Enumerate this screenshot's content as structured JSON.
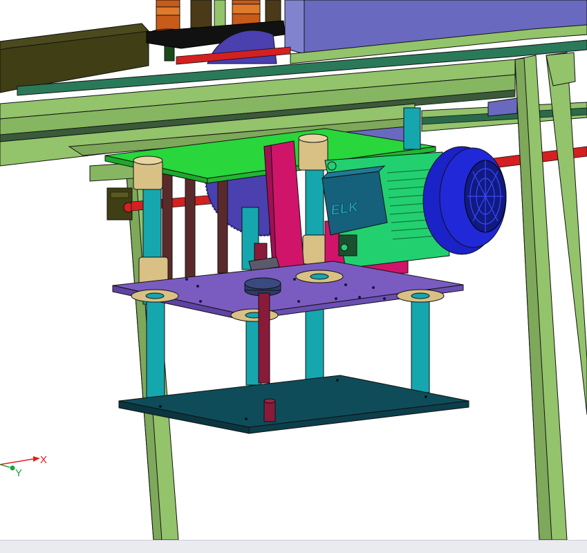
{
  "viewport": {
    "background": "#ffffff",
    "status_text": ""
  },
  "triad": {
    "x_label": "X",
    "y_label": "Y",
    "x_color": "#e0201e",
    "y_color": "#1ca23a"
  },
  "model": {
    "motor_brand": "ELK",
    "colors": {
      "frame": "#93c36b",
      "frame_dark": "#6fa04e",
      "motor_plate": "#29d63c",
      "middle_plate": "#7a5cc0",
      "bottom_plate": "#0f4c5a",
      "motor_body": "#15607a",
      "motor_fins": "#22d070",
      "motor_fan": "#1b22c8",
      "mount_bracket": "#d0146a",
      "guide_rod": "#16a6ae",
      "bushing": "#d9c084",
      "threaded_rod": "#5a2a2a",
      "saw_blade": "#4a40b0",
      "red_rail": "#d42020",
      "top_carriage": "#6a69c0",
      "dark_rail": "#2a5a3a"
    }
  }
}
